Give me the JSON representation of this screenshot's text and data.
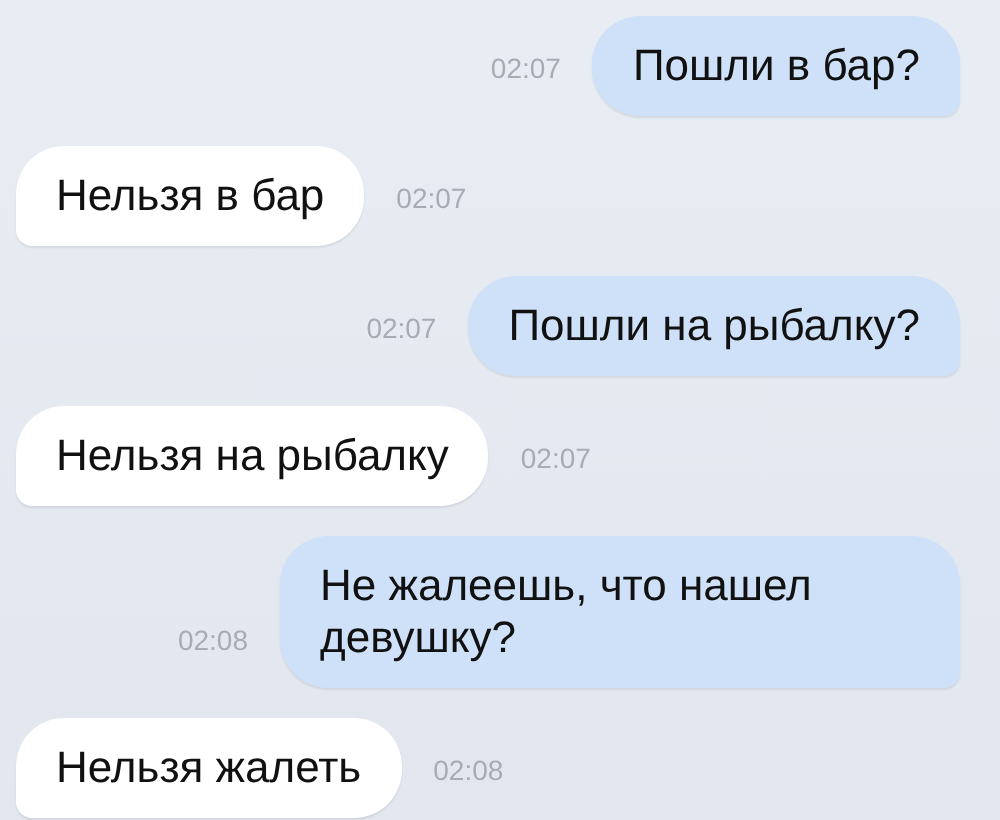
{
  "messages": [
    {
      "kind": "outgoing",
      "text": "Пошли в бар?",
      "time": "02:07"
    },
    {
      "kind": "incoming",
      "text": "Нельзя в бар",
      "time": "02:07"
    },
    {
      "kind": "outgoing",
      "text": "Пошли на рыбалку?",
      "time": "02:07"
    },
    {
      "kind": "incoming",
      "text": "Нельзя на рыбалку",
      "time": "02:07"
    },
    {
      "kind": "outgoing",
      "text": "Не жалеешь, что нашел девушку?",
      "time": "02:08"
    },
    {
      "kind": "incoming",
      "text": "Нельзя жалеть",
      "time": "02:08"
    }
  ]
}
